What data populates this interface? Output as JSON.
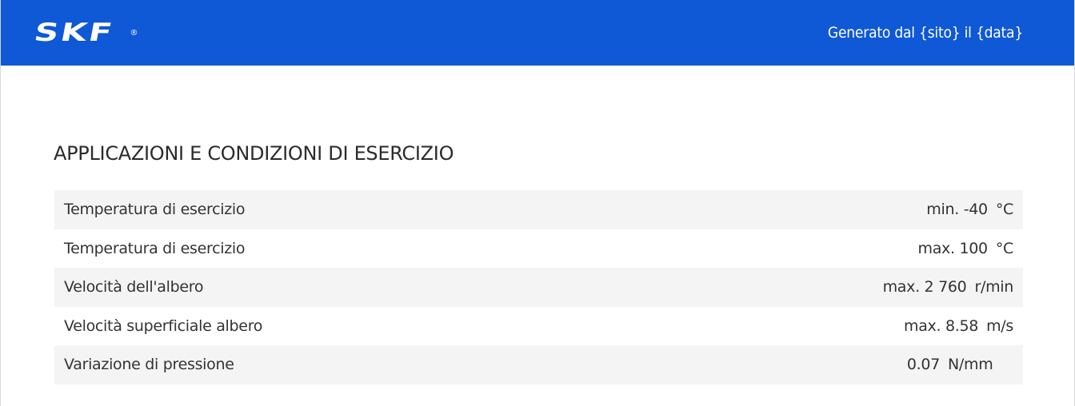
{
  "header": {
    "logo_text": "SKF",
    "logo_mark": "®",
    "generated": "Generato dal {sito} il {data}",
    "background": "#0f58d6"
  },
  "section": {
    "title": "APPLICAZIONI E CONDIZIONI DI ESERCIZIO"
  },
  "rows": [
    {
      "label": "Temperatura di esercizio",
      "value": "min. -40",
      "unit": "°C"
    },
    {
      "label": "Temperatura di esercizio",
      "value": "max. 100",
      "unit": "°C"
    },
    {
      "label": "Velocità dell'albero",
      "value": "max. 2 760",
      "unit": "r/min"
    },
    {
      "label": "Velocità superficiale albero",
      "value": "max. 8.58",
      "unit": "m/s"
    },
    {
      "label": "Variazione di pressione",
      "value": "0.07",
      "unit": "N/mm"
    }
  ]
}
